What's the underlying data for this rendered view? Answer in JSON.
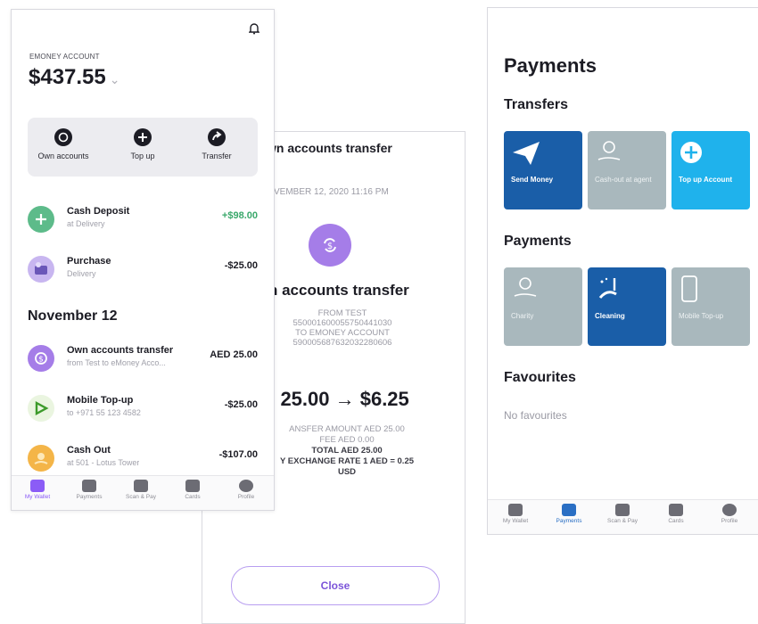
{
  "wallet": {
    "account_label": "EMONEY ACCOUNT",
    "balance": "$437.55",
    "balance_chevron": "⌄",
    "quick_actions": [
      {
        "label": "Own accounts",
        "icon": "swap-icon"
      },
      {
        "label": "Top up",
        "icon": "plus-icon"
      },
      {
        "label": "Transfer",
        "icon": "arrow-icon"
      }
    ],
    "transactions": [
      {
        "name": "Cash Deposit",
        "sub": "at Delivery",
        "amount": "+$98.00",
        "color": "#5dbb8a",
        "amount_color": "#3aa86b"
      },
      {
        "name": "Purchase",
        "sub": "Delivery",
        "amount": "-$25.00",
        "color": "#c8b6f0",
        "amount_color": "#1c1c24"
      }
    ],
    "section_date": "November 12",
    "transactions2": [
      {
        "name": "Own accounts transfer",
        "sub": "from Test to eMoney Acco...",
        "amount": "AED 25.00",
        "color": "#a57de8",
        "amount_color": "#1c1c24"
      },
      {
        "name": "Mobile Top-up",
        "sub": "to +971 55 123 4582",
        "amount": "-$25.00",
        "color": "#eaf5e0",
        "amount_color": "#1c1c24"
      },
      {
        "name": "Cash Out",
        "sub": "at 501 - Lotus Tower",
        "amount": "-$107.00",
        "color": "#f4b548",
        "amount_color": "#1c1c24"
      }
    ]
  },
  "nav": {
    "items": [
      "My Wallet",
      "Payments",
      "Scan & Pay",
      "Cards",
      "Profile"
    ]
  },
  "transfer": {
    "title": "wn accounts transfer",
    "date": "VEMBER 12, 2020 11:16 PM",
    "heading": "n accounts transfer",
    "lines": [
      "FROM TEST",
      "5500016000557504410​30",
      "TO EMONEY ACCOUNT",
      "59000568763203228060​6"
    ],
    "amount": ") 25.00 → $6.25",
    "summary": [
      "ANSFER AMOUNT AED 25.00",
      "FEE AED 0.00",
      "TOTAL AED 25.00",
      "Y EXCHANGE RATE 1 AED = 0.25",
      "USD"
    ],
    "close_label": "Close"
  },
  "payments": {
    "title": "Payments",
    "transfers_heading": "Transfers",
    "transfer_tiles": [
      {
        "label": "Send Money",
        "style": "blue"
      },
      {
        "label": "Cash-out at agent",
        "style": "grey"
      },
      {
        "label": "Top up Account",
        "style": "cyan"
      }
    ],
    "payments_heading": "Payments",
    "payment_tiles": [
      {
        "label": "Charity",
        "style": "grey"
      },
      {
        "label": "Cleaning",
        "style": "blue"
      },
      {
        "label": "Mobile Top-up",
        "style": "grey"
      }
    ],
    "favourites_heading": "Favourites",
    "no_favourites": "No favourites"
  }
}
